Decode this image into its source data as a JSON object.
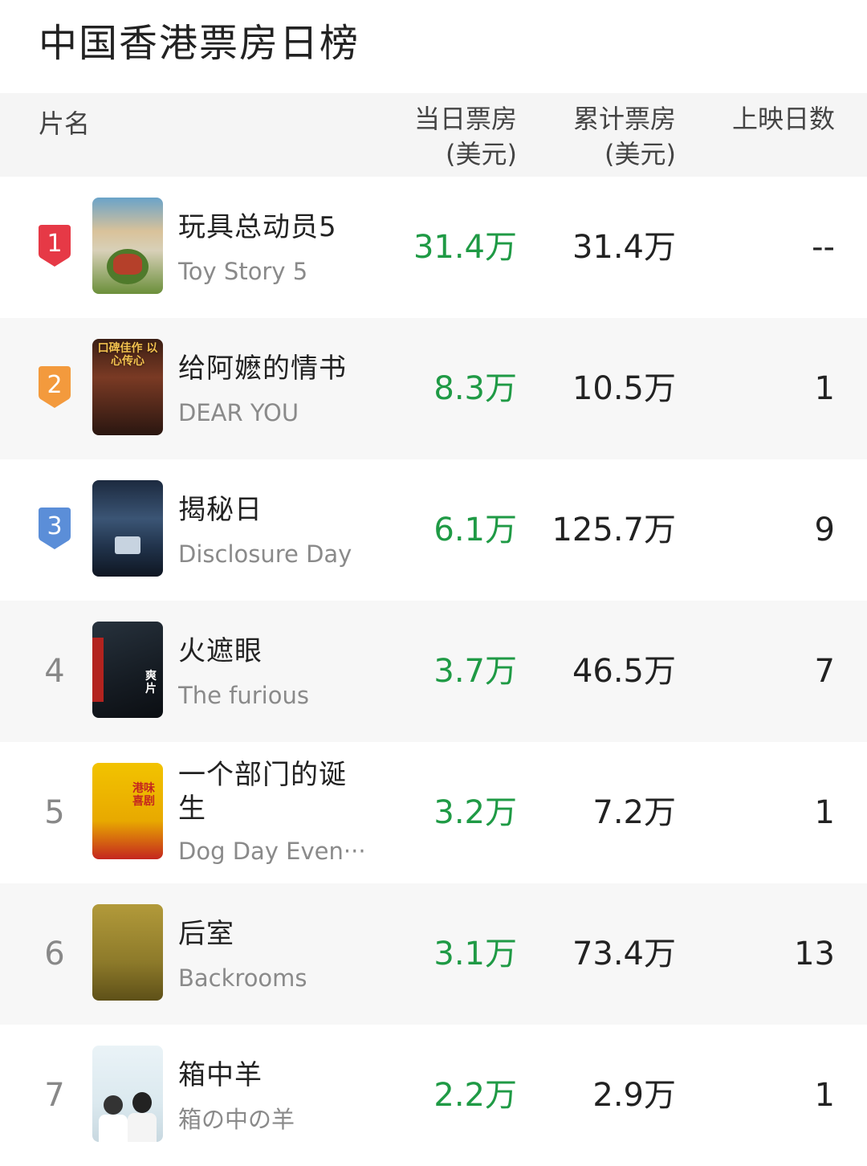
{
  "page": {
    "title": "中国香港票房日榜"
  },
  "table": {
    "headers": {
      "name": "片名",
      "day_gross_1": "当日票房",
      "day_gross_2": "(美元)",
      "total_gross_1": "累计票房",
      "total_gross_2": "(美元)",
      "days": "上映日数"
    },
    "rows": [
      {
        "rank": "1",
        "title_zh": "玩具总动员5",
        "title_en": "Toy Story 5",
        "day_gross": "31.4万",
        "total_gross": "31.4万",
        "days": "--",
        "poster_text": ""
      },
      {
        "rank": "2",
        "title_zh": "给阿嬷的情书",
        "title_en": "DEAR YOU",
        "day_gross": "8.3万",
        "total_gross": "10.5万",
        "days": "1",
        "poster_text": "口碑佳作 以心传心"
      },
      {
        "rank": "3",
        "title_zh": "揭秘日",
        "title_en": "Disclosure Day",
        "day_gross": "6.1万",
        "total_gross": "125.7万",
        "days": "9",
        "poster_text": ""
      },
      {
        "rank": "4",
        "title_zh": "火遮眼",
        "title_en": "The furious",
        "day_gross": "3.7万",
        "total_gross": "46.5万",
        "days": "7",
        "poster_text": "爽片"
      },
      {
        "rank": "5",
        "title_zh": "一个部门的诞生",
        "title_en": "Dog Day Even···",
        "day_gross": "3.2万",
        "total_gross": "7.2万",
        "days": "1",
        "poster_text": "港味喜剧"
      },
      {
        "rank": "6",
        "title_zh": "后室",
        "title_en": "Backrooms",
        "day_gross": "3.1万",
        "total_gross": "73.4万",
        "days": "13",
        "poster_text": ""
      },
      {
        "rank": "7",
        "title_zh": "箱中羊",
        "title_en": "箱の中の羊",
        "day_gross": "2.2万",
        "total_gross": "2.9万",
        "days": "1",
        "poster_text": ""
      }
    ]
  },
  "colors": {
    "rank1": "#e63946",
    "rank2": "#f39a3d",
    "rank3": "#5b8ed8",
    "day_gross": "#1f9a45"
  }
}
